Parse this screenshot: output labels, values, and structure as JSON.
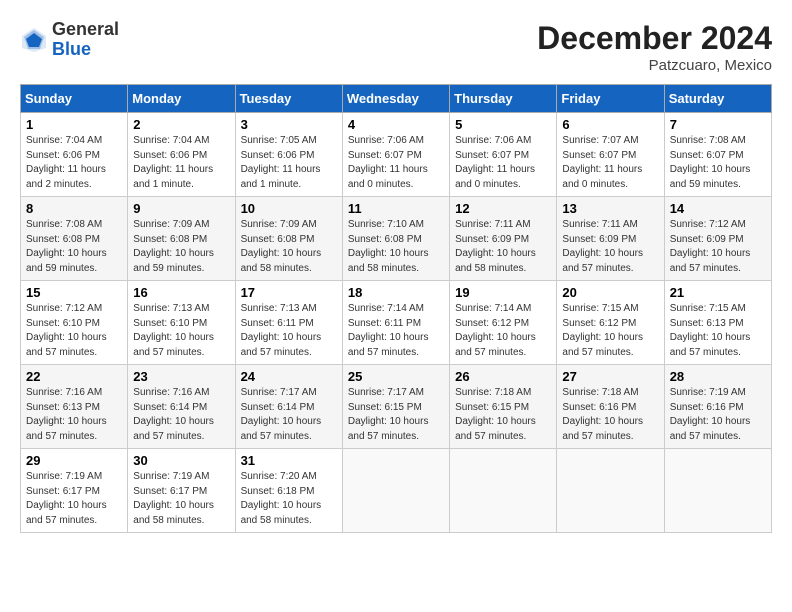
{
  "header": {
    "logo_general": "General",
    "logo_blue": "Blue",
    "month_title": "December 2024",
    "location": "Patzcuaro, Mexico"
  },
  "weekdays": [
    "Sunday",
    "Monday",
    "Tuesday",
    "Wednesday",
    "Thursday",
    "Friday",
    "Saturday"
  ],
  "weeks": [
    [
      {
        "day": "1",
        "sunrise": "7:04 AM",
        "sunset": "6:06 PM",
        "daylight": "11 hours and 2 minutes."
      },
      {
        "day": "2",
        "sunrise": "7:04 AM",
        "sunset": "6:06 PM",
        "daylight": "11 hours and 1 minute."
      },
      {
        "day": "3",
        "sunrise": "7:05 AM",
        "sunset": "6:06 PM",
        "daylight": "11 hours and 1 minute."
      },
      {
        "day": "4",
        "sunrise": "7:06 AM",
        "sunset": "6:07 PM",
        "daylight": "11 hours and 0 minutes."
      },
      {
        "day": "5",
        "sunrise": "7:06 AM",
        "sunset": "6:07 PM",
        "daylight": "11 hours and 0 minutes."
      },
      {
        "day": "6",
        "sunrise": "7:07 AM",
        "sunset": "6:07 PM",
        "daylight": "11 hours and 0 minutes."
      },
      {
        "day": "7",
        "sunrise": "7:08 AM",
        "sunset": "6:07 PM",
        "daylight": "10 hours and 59 minutes."
      }
    ],
    [
      {
        "day": "8",
        "sunrise": "7:08 AM",
        "sunset": "6:08 PM",
        "daylight": "10 hours and 59 minutes."
      },
      {
        "day": "9",
        "sunrise": "7:09 AM",
        "sunset": "6:08 PM",
        "daylight": "10 hours and 59 minutes."
      },
      {
        "day": "10",
        "sunrise": "7:09 AM",
        "sunset": "6:08 PM",
        "daylight": "10 hours and 58 minutes."
      },
      {
        "day": "11",
        "sunrise": "7:10 AM",
        "sunset": "6:08 PM",
        "daylight": "10 hours and 58 minutes."
      },
      {
        "day": "12",
        "sunrise": "7:11 AM",
        "sunset": "6:09 PM",
        "daylight": "10 hours and 58 minutes."
      },
      {
        "day": "13",
        "sunrise": "7:11 AM",
        "sunset": "6:09 PM",
        "daylight": "10 hours and 57 minutes."
      },
      {
        "day": "14",
        "sunrise": "7:12 AM",
        "sunset": "6:09 PM",
        "daylight": "10 hours and 57 minutes."
      }
    ],
    [
      {
        "day": "15",
        "sunrise": "7:12 AM",
        "sunset": "6:10 PM",
        "daylight": "10 hours and 57 minutes."
      },
      {
        "day": "16",
        "sunrise": "7:13 AM",
        "sunset": "6:10 PM",
        "daylight": "10 hours and 57 minutes."
      },
      {
        "day": "17",
        "sunrise": "7:13 AM",
        "sunset": "6:11 PM",
        "daylight": "10 hours and 57 minutes."
      },
      {
        "day": "18",
        "sunrise": "7:14 AM",
        "sunset": "6:11 PM",
        "daylight": "10 hours and 57 minutes."
      },
      {
        "day": "19",
        "sunrise": "7:14 AM",
        "sunset": "6:12 PM",
        "daylight": "10 hours and 57 minutes."
      },
      {
        "day": "20",
        "sunrise": "7:15 AM",
        "sunset": "6:12 PM",
        "daylight": "10 hours and 57 minutes."
      },
      {
        "day": "21",
        "sunrise": "7:15 AM",
        "sunset": "6:13 PM",
        "daylight": "10 hours and 57 minutes."
      }
    ],
    [
      {
        "day": "22",
        "sunrise": "7:16 AM",
        "sunset": "6:13 PM",
        "daylight": "10 hours and 57 minutes."
      },
      {
        "day": "23",
        "sunrise": "7:16 AM",
        "sunset": "6:14 PM",
        "daylight": "10 hours and 57 minutes."
      },
      {
        "day": "24",
        "sunrise": "7:17 AM",
        "sunset": "6:14 PM",
        "daylight": "10 hours and 57 minutes."
      },
      {
        "day": "25",
        "sunrise": "7:17 AM",
        "sunset": "6:15 PM",
        "daylight": "10 hours and 57 minutes."
      },
      {
        "day": "26",
        "sunrise": "7:18 AM",
        "sunset": "6:15 PM",
        "daylight": "10 hours and 57 minutes."
      },
      {
        "day": "27",
        "sunrise": "7:18 AM",
        "sunset": "6:16 PM",
        "daylight": "10 hours and 57 minutes."
      },
      {
        "day": "28",
        "sunrise": "7:19 AM",
        "sunset": "6:16 PM",
        "daylight": "10 hours and 57 minutes."
      }
    ],
    [
      {
        "day": "29",
        "sunrise": "7:19 AM",
        "sunset": "6:17 PM",
        "daylight": "10 hours and 57 minutes."
      },
      {
        "day": "30",
        "sunrise": "7:19 AM",
        "sunset": "6:17 PM",
        "daylight": "10 hours and 58 minutes."
      },
      {
        "day": "31",
        "sunrise": "7:20 AM",
        "sunset": "6:18 PM",
        "daylight": "10 hours and 58 minutes."
      },
      null,
      null,
      null,
      null
    ]
  ]
}
